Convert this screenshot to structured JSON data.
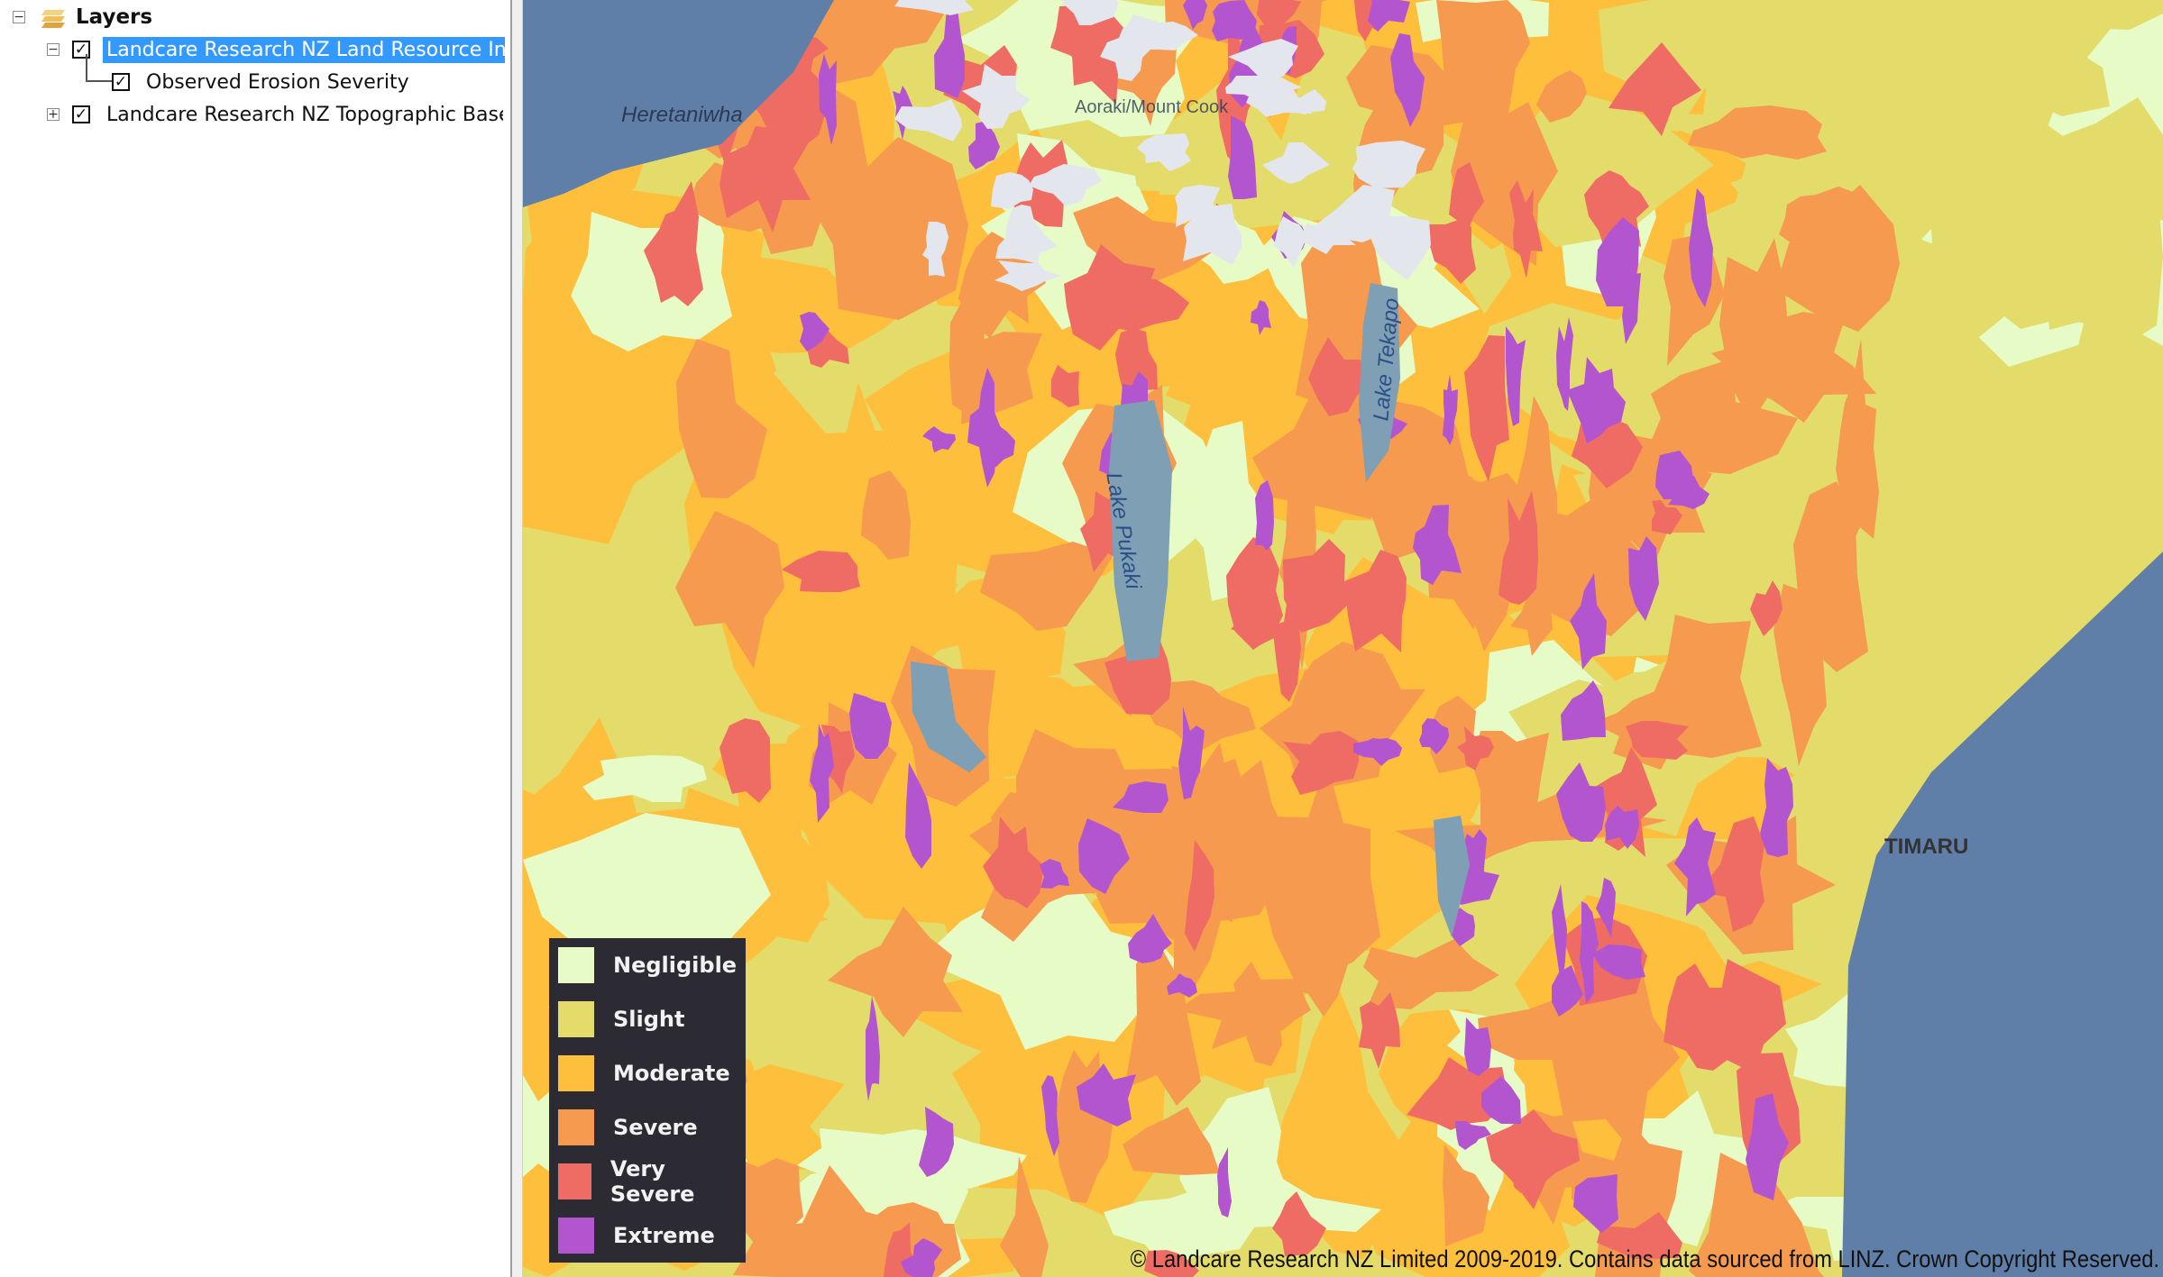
{
  "toc": {
    "root_label": "Layers",
    "layers": [
      {
        "label": "Landcare Research NZ Land Resource Inve",
        "checked": true,
        "expanded": true,
        "selected": true,
        "sublayers": [
          {
            "label": "Observed Erosion Severity",
            "checked": true
          }
        ]
      },
      {
        "label": "Landcare Research NZ Topographic Basel",
        "checked": true,
        "expanded": false
      }
    ]
  },
  "map": {
    "place_labels": {
      "heretaniwha": "Heretaniwha",
      "aoraki": "Aoraki/Mount Cook",
      "pukaki": "Lake Pukaki",
      "tekapo": "Lake Tekapo",
      "timaru": "TIMARU"
    },
    "colors": {
      "sea": "#5f7ea8",
      "lake": "#7f9fb5",
      "ice": "#e4e6ee"
    },
    "copyright": "© Landcare Research NZ Limited 2009-2019. Contains data sourced from LINZ. Crown Copyright Reserved."
  },
  "legend": {
    "items": [
      {
        "label": "Negligible",
        "color": "#e6fbc6"
      },
      {
        "label": "Slight",
        "color": "#e3dc6a"
      },
      {
        "label": "Moderate",
        "color": "#fdbf3c"
      },
      {
        "label": "Severe",
        "color": "#f59a4f"
      },
      {
        "label": "Very Severe",
        "color": "#ee6c63"
      },
      {
        "label": "Extreme",
        "color": "#b455d0"
      }
    ]
  }
}
